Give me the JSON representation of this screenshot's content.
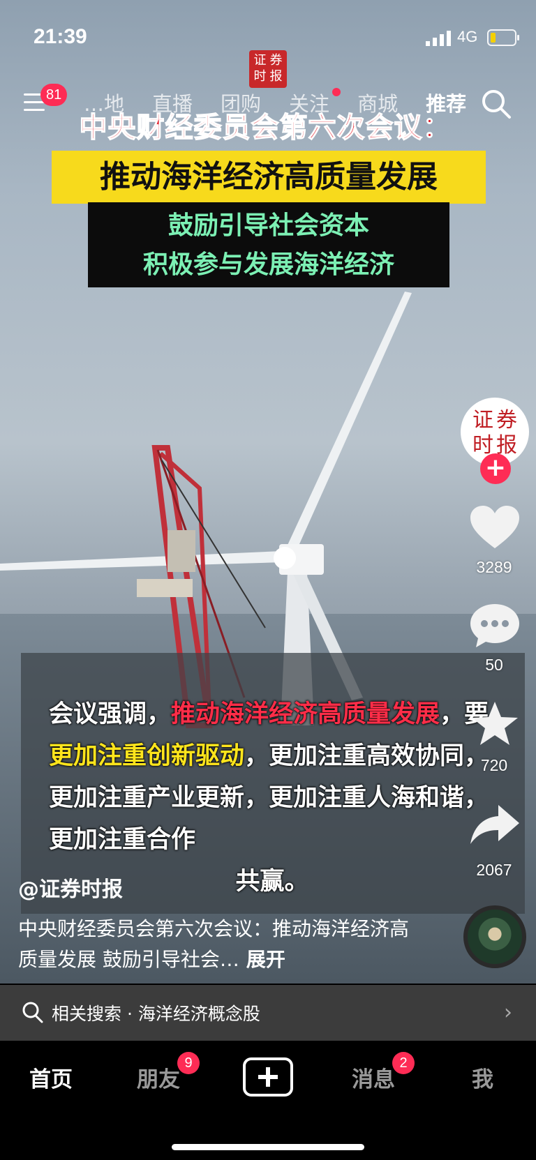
{
  "status_bar": {
    "time": "21:39",
    "network": "4G",
    "battery_level": 0.2
  },
  "top_nav": {
    "menu_badge": "81",
    "tabs": [
      {
        "label": "…地",
        "active": false
      },
      {
        "label": "直播",
        "active": false
      },
      {
        "label": "团购",
        "active": false
      },
      {
        "label": "关注",
        "active": false,
        "dot": true
      },
      {
        "label": "商城",
        "active": false
      },
      {
        "label": "推荐",
        "active": true
      }
    ],
    "search_icon": "search-icon",
    "menu_icon": "menu-icon"
  },
  "logo": {
    "chars": [
      "证",
      "券",
      "时",
      "报"
    ]
  },
  "video_overlay": {
    "headline": "中央财经委员会第六次会议：",
    "subtitle_yellow": "推动海洋经济高质量发展",
    "subtitle_green_1": "鼓励引导社会资本",
    "subtitle_green_2": "积极参与发展海洋经济"
  },
  "caption": {
    "part1": "会议强调，",
    "part2_red": "推动海洋经济高质量发展",
    "part3": "，要",
    "part4_yellow": "更加注重创新驱动",
    "part5": "，更加注重高效协同，更加注重产业更新，更加注重人海和谐，更加注重合作",
    "part6": "共赢。"
  },
  "rail": {
    "like_count": "3289",
    "comment_count": "50",
    "favorite_count": "720",
    "share_count": "2067",
    "follow_label": "+"
  },
  "author": "@证券时报",
  "description": "中央财经委员会第六次会议：推动海洋经济高质量发展 鼓励引导社会…",
  "expand_label": "展开",
  "related_search": {
    "text": "相关搜索 · 海洋经济概念股",
    "arrow": "›"
  },
  "bottom_nav": {
    "home": "首页",
    "friends": "朋友",
    "friends_badge": "9",
    "messages": "消息",
    "messages_badge": "2",
    "me": "我"
  },
  "colors": {
    "accent": "#fe2c55",
    "headline_red": "#e21e2a",
    "yellow_banner": "#f7da1c",
    "green_text": "#7cf0b4"
  }
}
